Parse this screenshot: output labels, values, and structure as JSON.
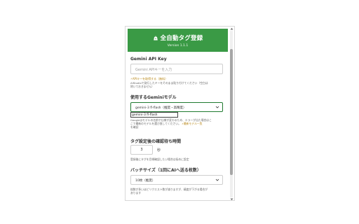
{
  "header": {
    "title": "全自動タグ登録",
    "version": "Version 1.1.1"
  },
  "api_key": {
    "label": "Gemini API Key",
    "placeholder": "Gemini APIキーを入力",
    "link": "APIキーを取得する（無料）",
    "hint_line1": "AIStudioで発行したキーをそのまま貼り付けてください（空白は",
    "hint_line2": "除いておきません）"
  },
  "model": {
    "label": "使用するGeminiモデル",
    "selected": "gemini-3 fl-flash（推奨・高精度）",
    "dropdown_option": "gemini-3 fl-flash",
    "hint_line1": "Googleはモデルの名前や仕様が変わるため、エラーが出た場合はこ",
    "hint_line2": "こで最新のモデルを選び直してください。",
    "hint_link": "最新モデル一覧",
    "hint_line3": "を確認"
  },
  "wait": {
    "label": "タグ設定後の確認待ち時間",
    "value": "3",
    "unit": "秒",
    "hint": "登録後にタグを目視確認したい場合は長めに設定"
  },
  "batch": {
    "label": "バッチサイズ（1回にAIへ送る枚数）",
    "selected": "10枚（推奨）",
    "hint_line1": "枚数が多いほどリクエスト数が減りますが、精度が下がる場合が",
    "hint_line2": "あります"
  },
  "colors": {
    "brand": "#3a9a45",
    "focus_border": "#1f7a2f"
  }
}
